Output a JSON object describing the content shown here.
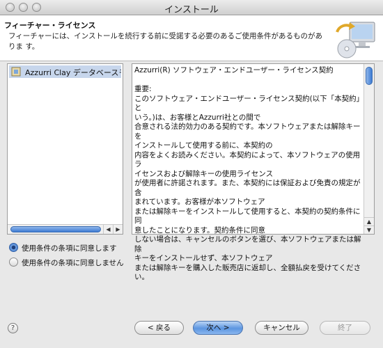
{
  "window": {
    "title": "インストール"
  },
  "header": {
    "title": "フィーチャー・ライセンス",
    "description": "フィーチャーには、インストールを続行する前に受諾する必要のあるご使用条件があるものがありま す。"
  },
  "features": [
    {
      "label": "Azzurri Clay データベースモ"
    }
  ],
  "license": {
    "text": "Azzurri(R) ソフトウェア・エンドユーザー・ライセンス契約\n\n重要:\nこのソフトウェア・エンドユーザー・ライセンス契約(以下「本契約」と\nいう。)は、お客様とAzzurri社との間で\n合意される法的効力のある契約です。本ソフトウェアまたは解除キーを\nインストールして使用する前に、本契約の\n内容をよくお読みください。本契約によって、本ソフトウェアの使用ラ\nイセンスおよび解除キーの使用ライセンス\nが使用者に許諾されます。また、本契約には保証および免責の規定が含\nまれています。お客様が本ソフトウェア\nまたは解除キーをインストールして使用すると、本契約の契約条件に同\n意したことになります。契約条件に同意\nしない場合は、キャンセルのボタンを選び、本ソフトウェアまたは解除\nキーをインストールせず、本ソフトウェア\nまたは解除キーを購入した販売店に返却し、全額払戻を受けてくださ\nい。"
  },
  "options": {
    "accept": {
      "label": "使用条件の条項に同意します",
      "checked": true
    },
    "decline": {
      "label": "使用条件の条項に同意しません",
      "checked": false
    }
  },
  "footer": {
    "help_icon": "question-icon",
    "help_glyph": "?",
    "back": "< 戻る",
    "next": "次へ >",
    "cancel": "キャンセル",
    "finish": "終了"
  },
  "scroll_arrows": {
    "left": "◀",
    "right": "▶",
    "up": "▲",
    "down": "▼"
  },
  "colors": {
    "selection": "#c7d6ec",
    "accent": "#3d7bd3"
  }
}
